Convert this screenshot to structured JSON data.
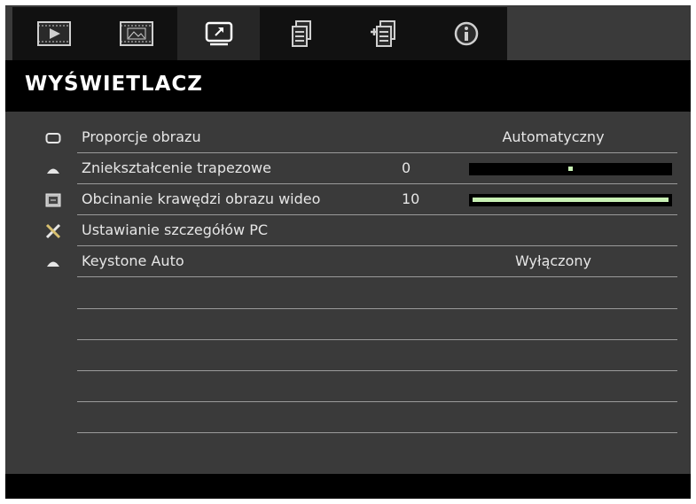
{
  "tabs": [
    {
      "icon": "play-icon",
      "label": ""
    },
    {
      "icon": "image-icon",
      "label": ""
    },
    {
      "icon": "display-icon",
      "label": "",
      "active": true
    },
    {
      "icon": "document-icon",
      "label": ""
    },
    {
      "icon": "settings-document-icon",
      "label": ""
    },
    {
      "icon": "info-icon",
      "label": ""
    }
  ],
  "header": {
    "title": "WYŚWIETLACZ"
  },
  "menu": {
    "items": [
      {
        "icon": "aspect-ratio-icon",
        "label": "Proporcje obrazu",
        "value": "",
        "setting": "Automatyczny"
      },
      {
        "icon": "keystone-icon",
        "label": "Zniekształcenie trapezowe",
        "value": "0",
        "setting": "",
        "slider_fraction": 0.5
      },
      {
        "icon": "overscan-icon",
        "label": "Obcinanie krawędzi obrazu wideo",
        "value": "10",
        "setting": "",
        "slider_fraction": 1.0
      },
      {
        "icon": "pc-tools-icon",
        "label": "Ustawianie szczegółów PC",
        "value": "",
        "setting": ""
      },
      {
        "icon": "keystone-auto-icon",
        "label": "Keystone Auto",
        "value": "",
        "setting": "Wyłączony"
      }
    ]
  },
  "colors": {
    "background": "#3a3a3a",
    "tab_inactive": "#111111",
    "tab_active": "#262626",
    "title_bar": "#000000",
    "text": "#e6e6e6",
    "slider_fill": "#c8f0b4"
  }
}
